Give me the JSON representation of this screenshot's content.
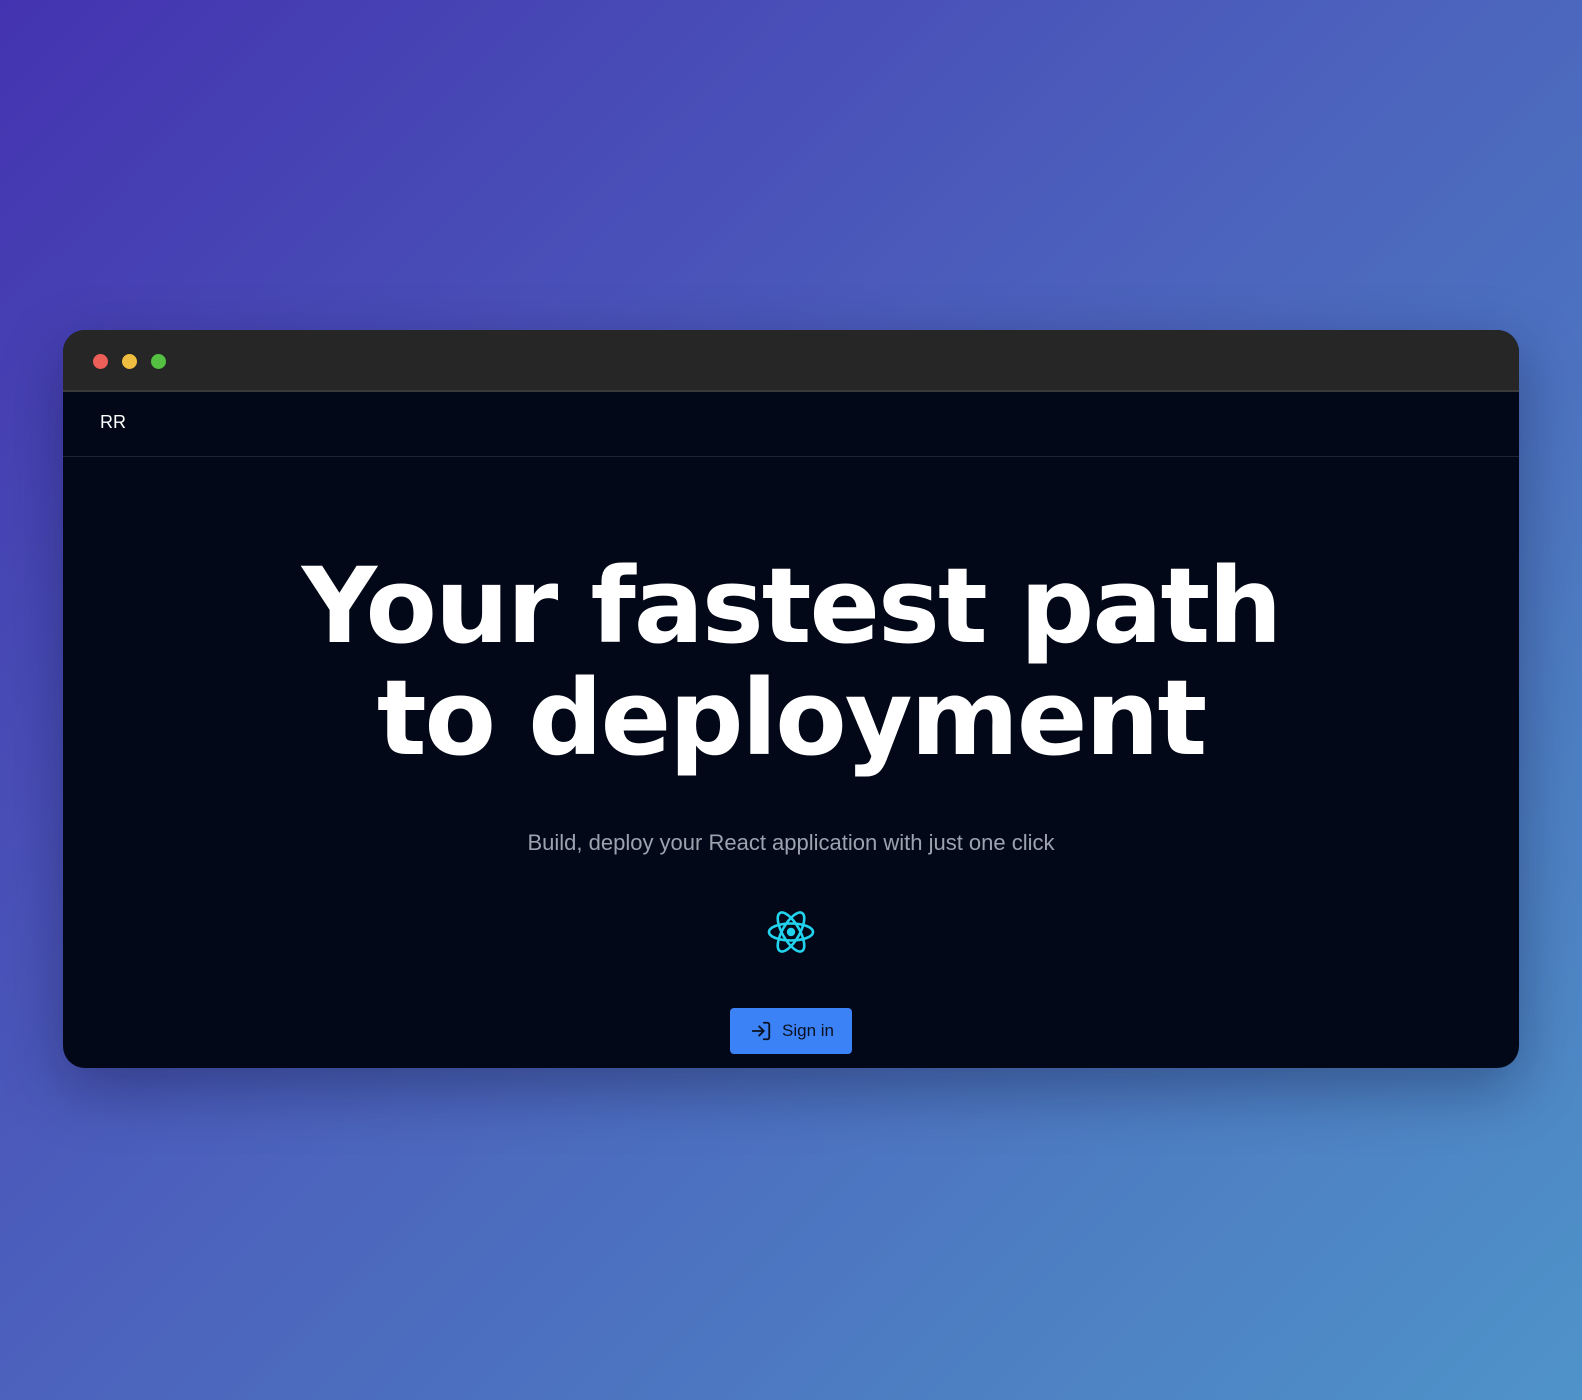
{
  "window": {
    "controls": [
      "close",
      "minimize",
      "maximize"
    ]
  },
  "navbar": {
    "brand": "RR"
  },
  "hero": {
    "headline": "Your fastest path to deployment",
    "subtitle": "Build, deploy your React application with just one click",
    "logo_icon": "react-logo-icon",
    "signin_label": "Sign in",
    "signin_icon": "sign-in-icon"
  },
  "colors": {
    "accent": "#3b82f6",
    "react": "#22d3ee",
    "background": "#030818"
  }
}
